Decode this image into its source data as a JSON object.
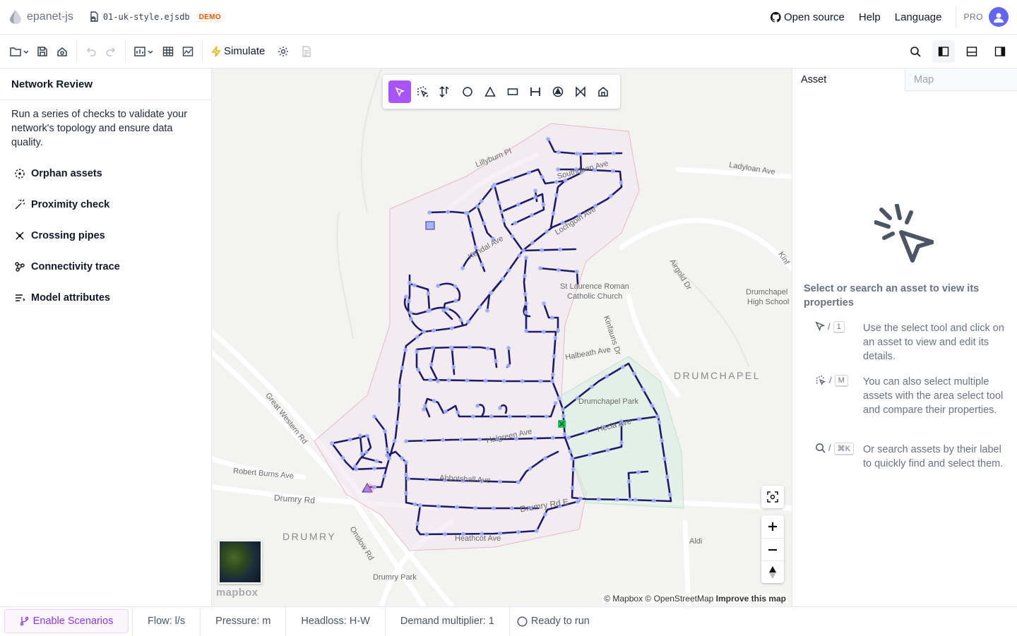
{
  "header": {
    "app_name": "epanet-js",
    "file_name": "01-uk-style.ejsdb",
    "demo_badge": "DEMO",
    "links": {
      "open_source": "Open source",
      "help": "Help",
      "language": "Language"
    },
    "pro": "PRO"
  },
  "toolbar": {
    "simulate": "Simulate"
  },
  "left_panel": {
    "title": "Network Review",
    "description": "Run a series of checks to validate your network's topology and ensure data quality.",
    "checks": [
      {
        "label": "Orphan assets",
        "icon": "dashed-circle-icon"
      },
      {
        "label": "Proximity check",
        "icon": "magic-wand-icon"
      },
      {
        "label": "Crossing pipes",
        "icon": "crossing-icon"
      },
      {
        "label": "Connectivity trace",
        "icon": "network-icon"
      },
      {
        "label": "Model attributes",
        "icon": "list-icon"
      }
    ]
  },
  "map": {
    "labels": {
      "lillyburn": "Lillyburn Pl",
      "ladyloan": "Ladyloan Ave",
      "airgold": "Airgold Dr",
      "kinf": "Kinf",
      "st_laurence_1": "St Laurence Roman",
      "st_laurence_2": "Catholic Church",
      "drumchapel_hs_1": "Drumchapel",
      "drumchapel_hs_2": "High School",
      "kinfauns": "Kinfauns Dr",
      "halbeath": "Halbeath Ave",
      "drumchapel_area": "DRUMCHAPEL",
      "drumchapel_park": "Drumchapel Park",
      "hecla": "Hecla Ave",
      "great_western": "Great Western Rd",
      "robert_burns": "Robert Burns Ave",
      "drumry_rd": "Drumry Rd",
      "drumry_area": "DRUMRY",
      "onslow": "Onslow Rd",
      "drumry_park": "Drumry Park",
      "abbotshall": "Abbotshall Ave",
      "heathcot": "Heathcot Ave",
      "drumry_rd_e": "Drumry Rd E",
      "aldi": "Aldi",
      "halgreen": "Halgreen Ave",
      "lochgoin": "Lochgoin Ave",
      "kendal": "Kendal Ave",
      "southdeen": "Southdeen Ave"
    },
    "mapbox_logo": "mapbox",
    "attribution": "© Mapbox © OpenStreetMap",
    "improve": "Improve this map"
  },
  "right_panel": {
    "tabs": {
      "asset": "Asset",
      "map": "Map"
    },
    "empty_title": "Select or search an asset to view its properties",
    "hints": [
      {
        "key": "1",
        "text": "Use the select tool and click on an asset to view and edit its details."
      },
      {
        "key": "M",
        "text": "You can also select multiple assets with the area select tool and compare their properties."
      },
      {
        "key": "⌘K",
        "text": "Or search assets by their label to quickly find and select them."
      }
    ],
    "separator": "/"
  },
  "status_bar": {
    "scenarios": "Enable Scenarios",
    "flow": "Flow: l/s",
    "pressure": "Pressure: m",
    "headloss": "Headloss: H-W",
    "demand": "Demand multiplier: 1",
    "status": "Ready to run"
  }
}
